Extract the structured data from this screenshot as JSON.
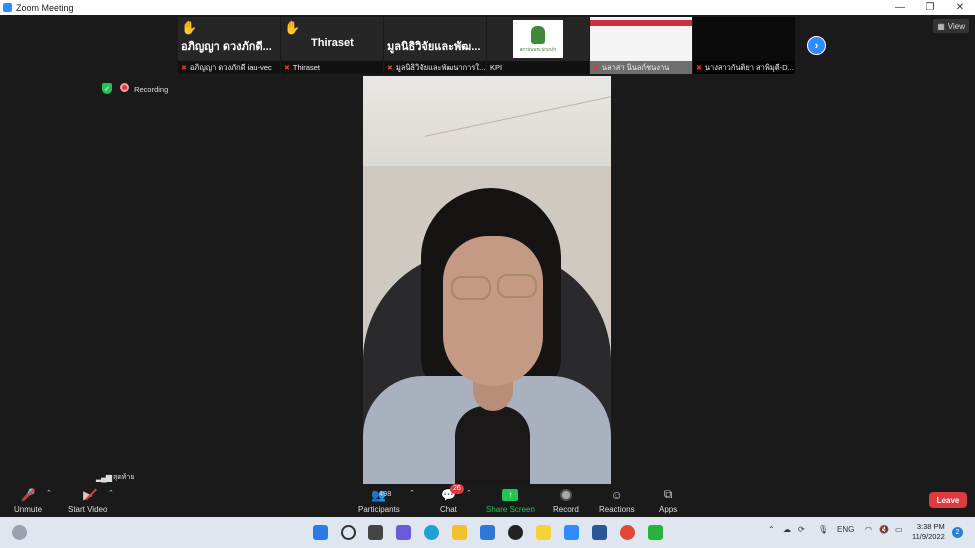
{
  "window": {
    "title": "Zoom Meeting",
    "minimize": "—",
    "maximize": "❐",
    "close": "✕"
  },
  "view_button": {
    "label": "View"
  },
  "gallery": [
    {
      "big_text": "อภิญญา ดวงภักดี...",
      "caption": "อภิญญา ดวงภักดี iau-vec",
      "hand": "✋",
      "muted": true
    },
    {
      "big_text": "Thiraset",
      "caption": "Thiraset",
      "hand": "✋",
      "muted": true
    },
    {
      "big_text": "มูลนิธิวิจัยและพัฒ...",
      "caption": "มูลนิธิวิจัยและพัฒนาการใ...",
      "muted": true
    },
    {
      "logo_text": "สถาบันพระปกเกล้า",
      "caption": "KPI",
      "muted": false
    },
    {
      "caption": "นลาสา นินลก์ชนงาน",
      "muted": true
    },
    {
      "caption": "นางสาวกันติยา สาพิมุตี-D...",
      "muted": true
    }
  ],
  "status": {
    "recording_label": "Recording"
  },
  "toolbar": {
    "unmute": "Unmute",
    "start_video": "Start Video",
    "network_label": "สุดท้าย",
    "participants": "Participants",
    "participants_count": "498",
    "chat": "Chat",
    "chat_badge": "26",
    "share_screen": "Share Screen",
    "record": "Record",
    "reactions": "Reactions",
    "apps": "Apps",
    "leave": "Leave"
  },
  "taskbar": {
    "language": "ENG",
    "time": "3:38 PM",
    "date": "11/9/2022",
    "notifications": "2"
  },
  "colors": {
    "accent": "#2d8cff",
    "danger": "#e0393e",
    "share_green": "#23c552"
  }
}
